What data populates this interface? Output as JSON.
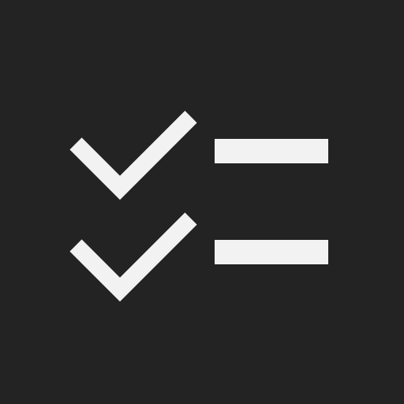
{
  "icon": {
    "name": "checklist-icon",
    "background_color": "#232323",
    "foreground_color": "#F2F2F2",
    "rows": [
      {
        "checked": true
      },
      {
        "checked": true
      }
    ]
  }
}
